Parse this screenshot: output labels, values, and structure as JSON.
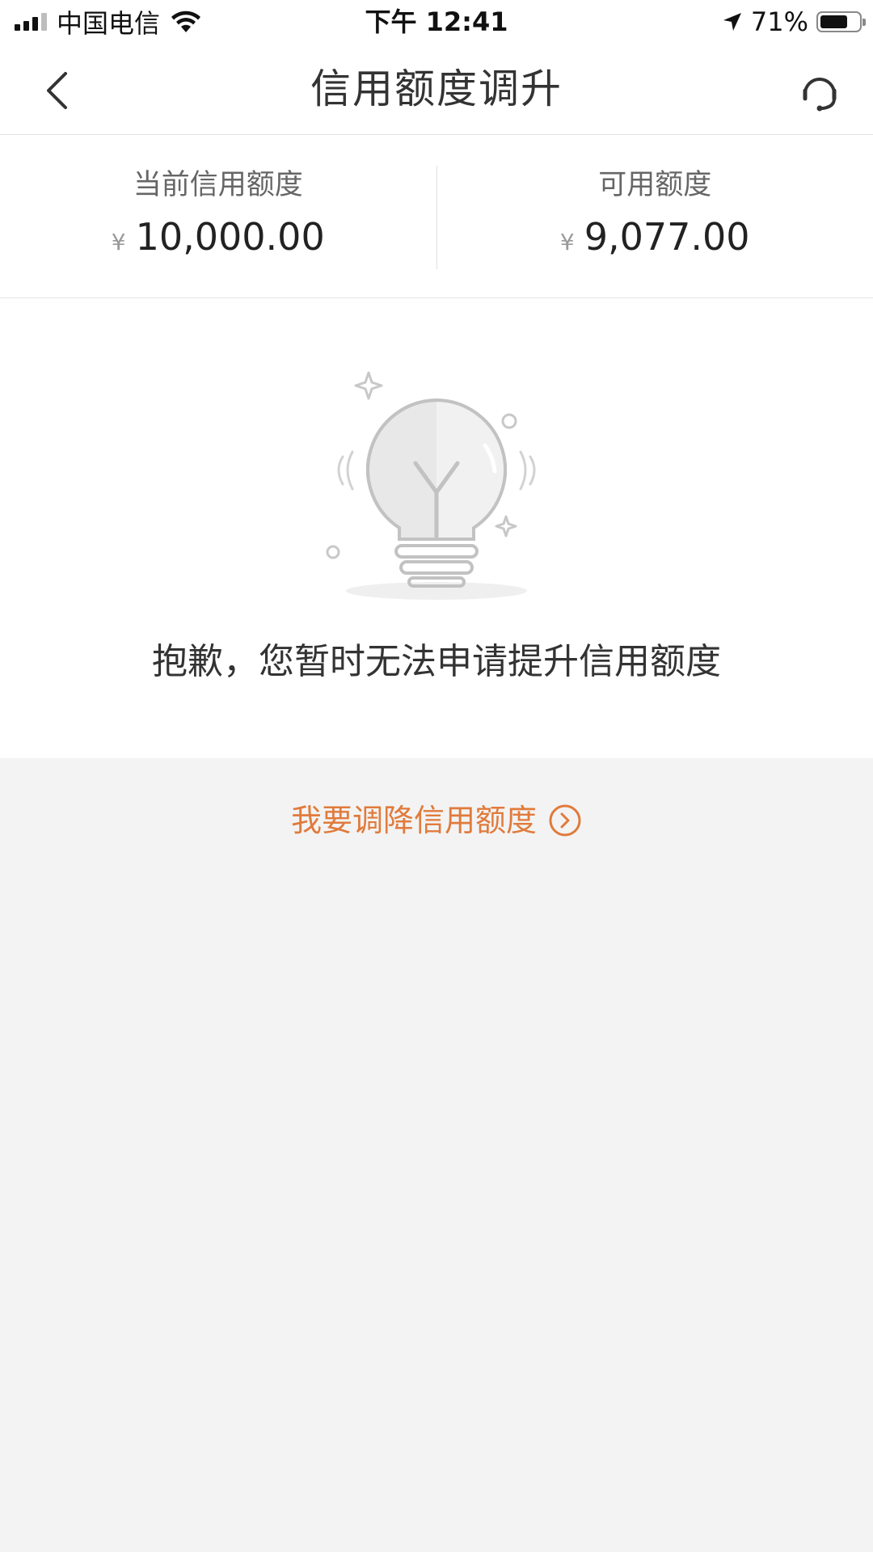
{
  "status_bar": {
    "carrier": "中国电信",
    "time": "下午 12:41",
    "battery": "71%",
    "battery_level": 0.71
  },
  "nav": {
    "title": "信用额度调升",
    "back_icon": "chevron-left-icon",
    "service_icon": "headset-icon"
  },
  "limits": {
    "current": {
      "label": "当前信用额度",
      "currency": "¥",
      "amount": "10,000.00"
    },
    "available": {
      "label": "可用额度",
      "currency": "¥",
      "amount": "9,077.00"
    }
  },
  "message": {
    "illustration_icon": "lightbulb-icon",
    "text": "抱歉，您暂时无法申请提升信用额度"
  },
  "reduce_link": {
    "label": "我要调降信用额度",
    "icon": "arrow-circle-right-icon",
    "color": "#e07b3c"
  }
}
